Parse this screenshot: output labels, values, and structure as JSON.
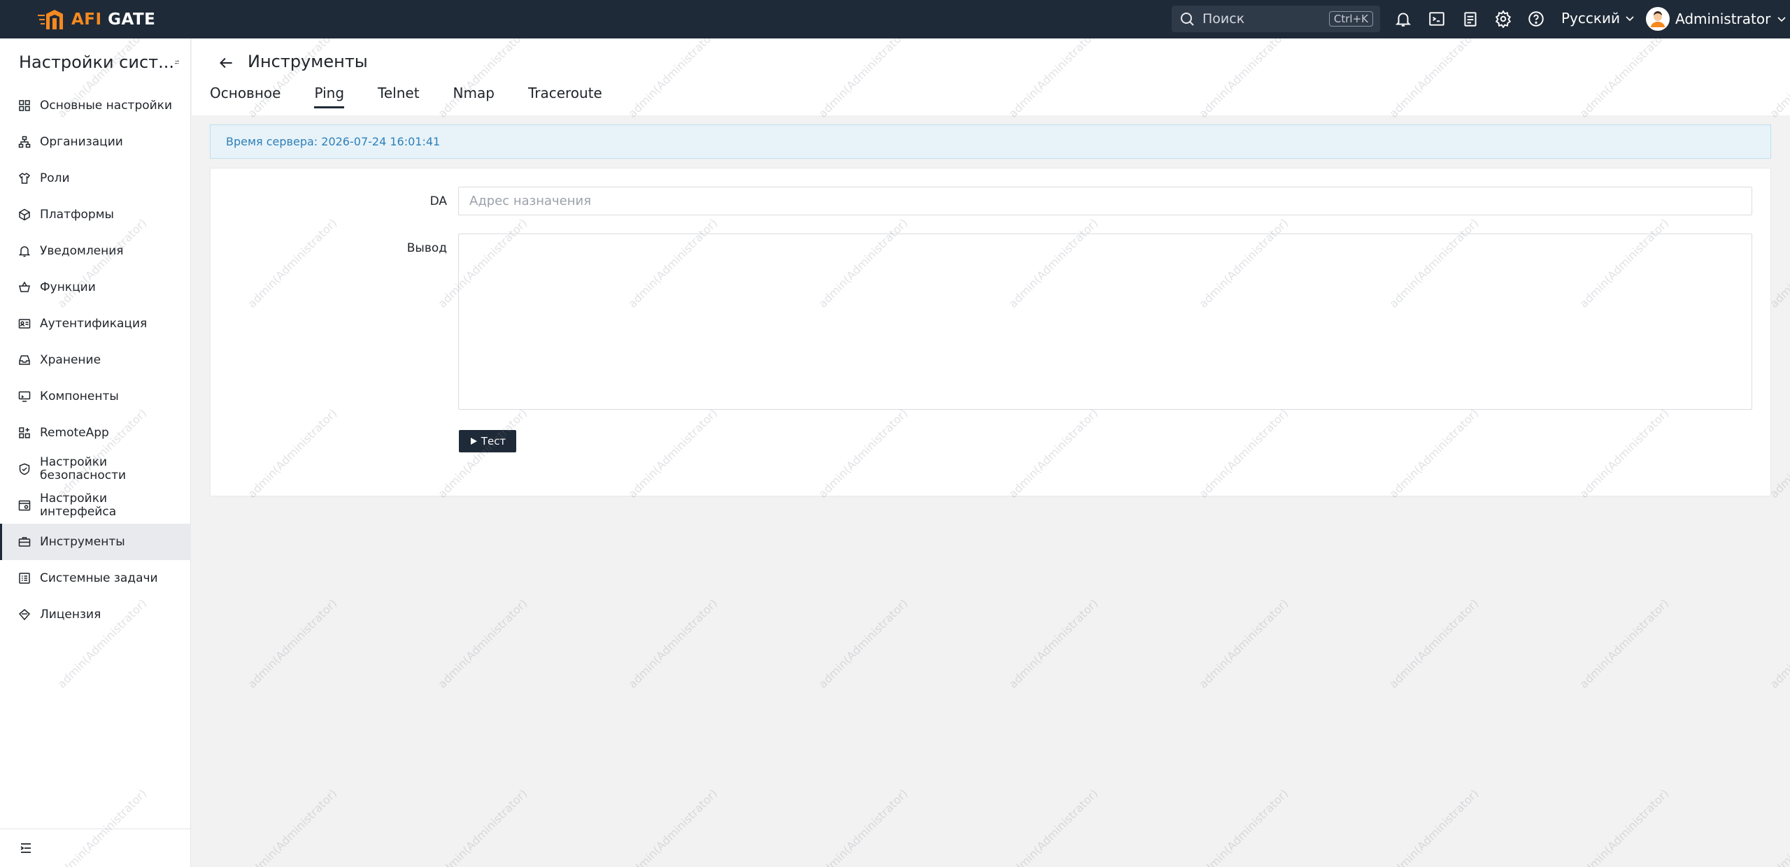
{
  "app": {
    "logo_text_accent": "AFI",
    "logo_text_rest": "GATE",
    "brand_color": "#f5891f"
  },
  "topbar": {
    "search_placeholder": "Поиск",
    "search_shortcut": "Ctrl+K",
    "language": "Русский",
    "user_name": "Administrator",
    "icons": [
      "bell-icon",
      "terminal-icon",
      "clipboard-icon",
      "gear-icon",
      "help-icon"
    ]
  },
  "sidebar": {
    "title": "Настройки сист...",
    "items": [
      {
        "label": "Основные настройки",
        "icon": "grid-icon"
      },
      {
        "label": "Организации",
        "icon": "org-icon"
      },
      {
        "label": "Роли",
        "icon": "shirt-icon"
      },
      {
        "label": "Платформы",
        "icon": "cube-icon"
      },
      {
        "label": "Уведомления",
        "icon": "bell-icon"
      },
      {
        "label": "Функции",
        "icon": "basket-icon"
      },
      {
        "label": "Аутентификация",
        "icon": "id-card-icon"
      },
      {
        "label": "Хранение",
        "icon": "inbox-icon"
      },
      {
        "label": "Компоненты",
        "icon": "monitor-icon"
      },
      {
        "label": "RemoteApp",
        "icon": "apps-icon"
      },
      {
        "label": "Настройки безопасности",
        "icon": "shield-icon"
      },
      {
        "label": "Настройки интерфейса",
        "icon": "interface-icon"
      },
      {
        "label": "Инструменты",
        "icon": "toolbox-icon",
        "active": true
      },
      {
        "label": "Системные задачи",
        "icon": "tasks-icon"
      },
      {
        "label": "Лицензия",
        "icon": "diamond-icon"
      }
    ]
  },
  "content": {
    "title": "Инструменты",
    "tabs": [
      {
        "label": "Основное"
      },
      {
        "label": "Ping",
        "active": true
      },
      {
        "label": "Telnet"
      },
      {
        "label": "Nmap"
      },
      {
        "label": "Traceroute"
      }
    ],
    "server_time": "Время сервера: 2026-07-24 16:01:41",
    "form": {
      "da_label": "DA",
      "da_placeholder": "Адрес назначения",
      "da_value": "",
      "output_label": "Вывод",
      "output_value": "",
      "test_button": "Тест"
    }
  },
  "watermark": "admin(Administrator)"
}
